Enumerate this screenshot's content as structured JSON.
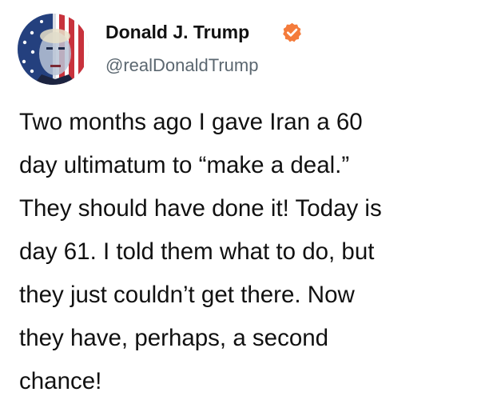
{
  "author": {
    "display_name": "Donald J. Trump",
    "handle": "@realDonaldTrump",
    "verified": true,
    "verified_badge_color": "#f47b3b",
    "avatar_icon": "profile-avatar-flag-portrait"
  },
  "post": {
    "lines": [
      "Two months ago I gave Iran a 60",
      "day ultimatum to “make a deal.”",
      "They should have done it! Today is",
      "day 61. I told them what to do, but",
      "they just couldn’t get there. Now",
      "they have, perhaps, a second",
      "chance!"
    ]
  },
  "colors": {
    "text": "#111111",
    "handle": "#5b6770",
    "background": "#ffffff"
  }
}
